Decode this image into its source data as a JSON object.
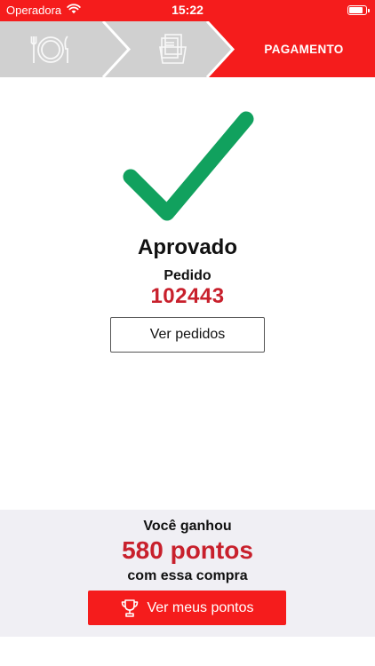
{
  "status_bar": {
    "carrier": "Operadora",
    "time": "15:22",
    "wifi_icon": "wifi-icon",
    "battery_icon": "battery-icon",
    "battery_level": 0.9
  },
  "steps": {
    "items": [
      {
        "icon": "cutlery-plate-icon",
        "state": "done"
      },
      {
        "icon": "documents-icon",
        "state": "done"
      },
      {
        "label": "PAGAMENTO",
        "state": "active"
      }
    ],
    "colors": {
      "inactive": "#d0d0d0",
      "active": "#f51c1c"
    }
  },
  "result": {
    "icon": "checkmark-icon",
    "title": "Aprovado",
    "order_label": "Pedido",
    "order_number": "102443",
    "view_orders_label": "Ver pedidos"
  },
  "points": {
    "intro": "Você ganhou",
    "value": "580 pontos",
    "suffix": "com essa compra",
    "button_label": "Ver meus pontos",
    "button_icon": "trophy-icon"
  },
  "colors": {
    "brand_red": "#f51c1c",
    "number_red": "#c8202c",
    "success_green": "#11a15e",
    "panel_bg": "#f0eff4"
  }
}
